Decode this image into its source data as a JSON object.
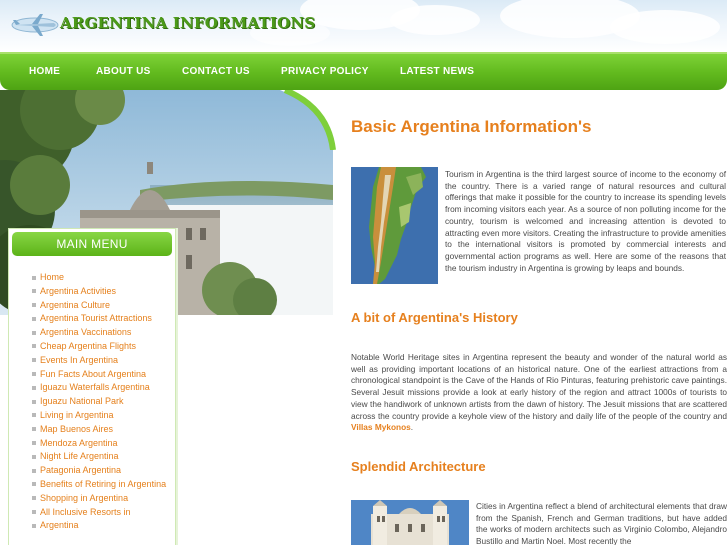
{
  "header": {
    "logo_text": "ARGENTINA INFORMATIONS",
    "logo_icon": "airplane-icon"
  },
  "nav": {
    "items": [
      {
        "label": "HOME"
      },
      {
        "label": "ABOUT US"
      },
      {
        "label": "CONTACT US"
      },
      {
        "label": "PRIVACY POLICY"
      },
      {
        "label": "LATEST NEWS"
      }
    ]
  },
  "sidebar": {
    "title": "MAIN MENU",
    "items": [
      {
        "label": "Home"
      },
      {
        "label": "Argentina Activities"
      },
      {
        "label": "Argentina Culture"
      },
      {
        "label": "Argentina Tourist Attractions"
      },
      {
        "label": "Argentina Vaccinations"
      },
      {
        "label": "Cheap Argentina Flights"
      },
      {
        "label": "Events In Argentina"
      },
      {
        "label": "Fun Facts About Argentina"
      },
      {
        "label": "Iguazu Waterfalls Argentina"
      },
      {
        "label": "Iguazu National Park"
      },
      {
        "label": "Living in Argentina"
      },
      {
        "label": "Map Buenos Aires"
      },
      {
        "label": "Mendoza Argentina"
      },
      {
        "label": "Night Life Argentina"
      },
      {
        "label": "Patagonia Argentina"
      },
      {
        "label": "Benefits of Retiring in Argentina"
      },
      {
        "label": "Shopping in Argentina"
      },
      {
        "label": "All Inclusive Resorts in"
      },
      {
        "label": "Argentina"
      }
    ]
  },
  "content": {
    "title": "Basic Argentina Information's",
    "intro": "Tourism in Argentina is the third largest source of income to the economy of the country. There is a varied range of natural resources and cultural offerings that make it possible for the country to increase its spending levels from incoming visitors each year. As a source of non polluting income for the country, tourism is welcomed and increasing attention is devoted to attracting even more visitors. Creating the infrastructure to provide amenities to the international visitors is promoted by commercial interests and governmental action programs as well. Here are some of the reasons that the tourism industry in Argentina is growing by leaps and bounds.",
    "history_heading": "A bit of Argentina's History",
    "history_text": "Notable World Heritage sites in Argentina represent the beauty and wonder of the natural world as well as providing important locations of an historical nature. One of the earliest attractions from a chronological standpoint is the Cave of the Hands of Rio Pinturas, featuring prehistoric cave paintings. Several Jesuit missions provide a look at early history of the region and attract 1000s of tourists to view the handiwork of unknown artists from the dawn of history. The Jesuit missions that are scattered across the country provide a keyhole view of the history and daily life of the people of the country and",
    "history_link": "Villas Mykonos",
    "history_end": ".",
    "architecture_heading": "Splendid Architecture",
    "architecture_text": "Cities in Argentina reflect a blend of architectural elements that draw from the Spanish, French and German traditions, but have added the works of modern architects such as Virginio Colombo, Alejandro Bustillo and Martin Noel. Most recently the"
  },
  "colors": {
    "nav_green": "#63bb1f",
    "accent_orange": "#e6801e",
    "logo_green": "#4c9a19",
    "body_text": "#4a4a4a"
  }
}
